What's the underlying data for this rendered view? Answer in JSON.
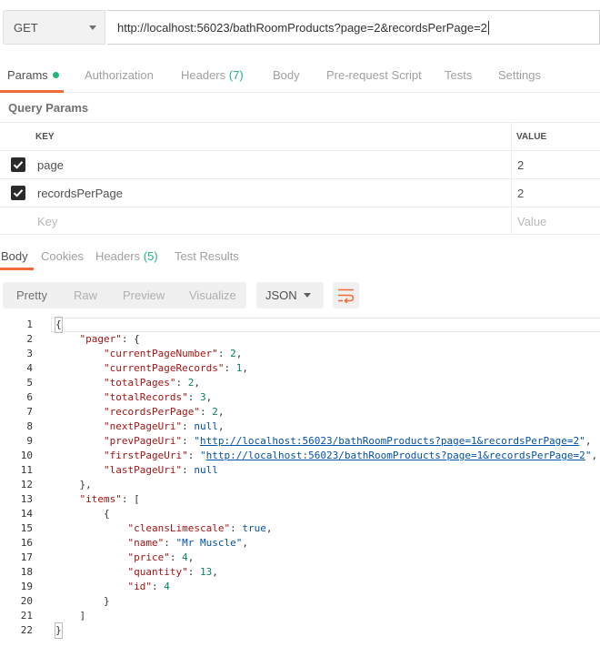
{
  "request": {
    "method": "GET",
    "url": "http://localhost:56023/bathRoomProducts?page=2&recordsPerPage=2"
  },
  "request_tabs": {
    "params": "Params",
    "authorization": "Authorization",
    "headers": "Headers",
    "headers_count": "(7)",
    "body": "Body",
    "prerequest": "Pre-request Script",
    "tests": "Tests",
    "settings": "Settings"
  },
  "query_params": {
    "title": "Query Params",
    "col_key": "KEY",
    "col_value": "VALUE",
    "rows": [
      {
        "key": "page",
        "value": "2",
        "checked": true
      },
      {
        "key": "recordsPerPage",
        "value": "2",
        "checked": true
      }
    ],
    "placeholder_key": "Key",
    "placeholder_value": "Value"
  },
  "response_tabs": {
    "body": "Body",
    "cookies": "Cookies",
    "headers": "Headers",
    "headers_count": "(5)",
    "test_results": "Test Results"
  },
  "toolbar": {
    "pretty": "Pretty",
    "raw": "Raw",
    "preview": "Preview",
    "visualize": "Visualize",
    "format": "JSON"
  },
  "code_lines": [
    {
      "n": "1",
      "t": "{"
    },
    {
      "n": "2",
      "t": "    \"pager\": {"
    },
    {
      "n": "3",
      "t": "        \"currentPageNumber\": 2,"
    },
    {
      "n": "4",
      "t": "        \"currentPageRecords\": 1,"
    },
    {
      "n": "5",
      "t": "        \"totalPages\": 2,"
    },
    {
      "n": "6",
      "t": "        \"totalRecords\": 3,"
    },
    {
      "n": "7",
      "t": "        \"recordsPerPage\": 2,"
    },
    {
      "n": "8",
      "t": "        \"nextPageUri\": null,"
    },
    {
      "n": "9",
      "t": "        \"prevPageUri\": \"http://localhost:56023/bathRoomProducts?page=1&recordsPerPage=2\","
    },
    {
      "n": "10",
      "t": "        \"firstPageUri\": \"http://localhost:56023/bathRoomProducts?page=1&recordsPerPage=2\","
    },
    {
      "n": "11",
      "t": "        \"lastPageUri\": null"
    },
    {
      "n": "12",
      "t": "    },"
    },
    {
      "n": "13",
      "t": "    \"items\": ["
    },
    {
      "n": "14",
      "t": "        {"
    },
    {
      "n": "15",
      "t": "            \"cleansLimescale\": true,"
    },
    {
      "n": "16",
      "t": "            \"name\": \"Mr Muscle\","
    },
    {
      "n": "17",
      "t": "            \"price\": 4,"
    },
    {
      "n": "18",
      "t": "            \"quantity\": 13,"
    },
    {
      "n": "19",
      "t": "            \"id\": 4"
    },
    {
      "n": "20",
      "t": "        }"
    },
    {
      "n": "21",
      "t": "    ]"
    },
    {
      "n": "22",
      "t": "}"
    }
  ],
  "colors": {
    "accent": "#f26b3a",
    "green": "#26b47f"
  }
}
